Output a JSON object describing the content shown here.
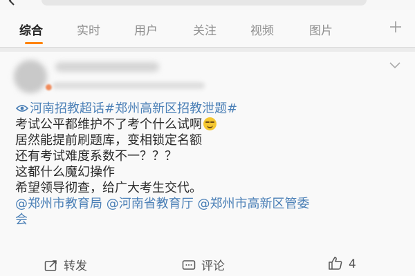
{
  "tabs": [
    {
      "label": "综合",
      "active": true
    },
    {
      "label": "实时",
      "active": false
    },
    {
      "label": "用户",
      "active": false
    },
    {
      "label": "关注",
      "active": false
    },
    {
      "label": "视频",
      "active": false
    },
    {
      "label": "图片",
      "active": false
    }
  ],
  "accent_color": "#ff8200",
  "link_color": "#4a7fb6",
  "icons": [
    "back-arrow-icon",
    "add-tab-icon",
    "chevron-down-icon",
    "topic-link-icon",
    "grimace-emoji-icon",
    "repost-icon",
    "comment-icon",
    "like-icon"
  ],
  "post": {
    "topic_tags": "河南招教超话#郑州高新区招教泄题#",
    "lines": [
      "考试公平都维护不了考个什么试啊",
      "居然能提前刷题库，变相锁定名额",
      "还有考试难度系数不一？？？",
      "这都什么魔幻操作",
      "希望领导彻查，给广大考生交代。"
    ],
    "mentions_line1": "@郑州市教育局 @河南省教育厅 @郑州市高新区管委",
    "mentions_line2": "会"
  },
  "actions": {
    "repost_label": "转发",
    "comment_label": "评论",
    "like_count": "4"
  }
}
